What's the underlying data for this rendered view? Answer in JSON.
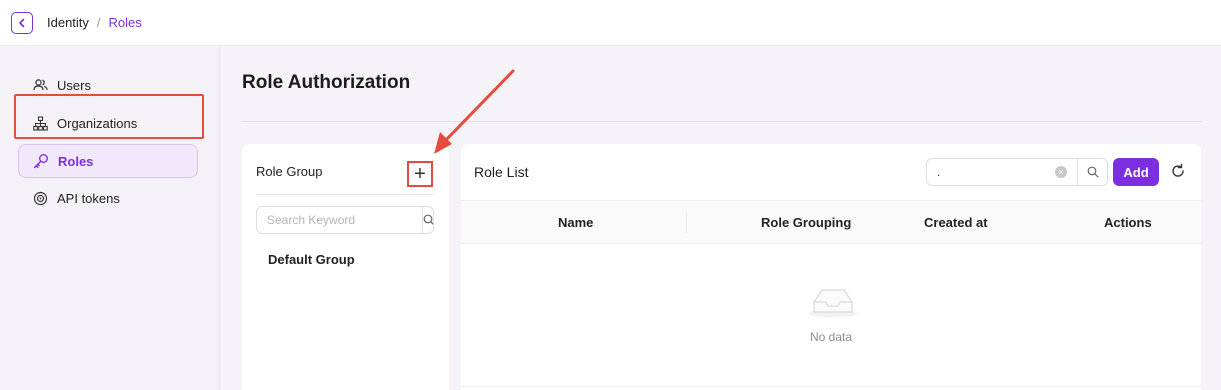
{
  "breadcrumb": {
    "parent": "Identity",
    "separator": "/",
    "current": "Roles"
  },
  "sidebar": {
    "items": [
      {
        "label": "Users",
        "icon": "users-icon"
      },
      {
        "label": "Organizations",
        "icon": "org-tree-icon"
      },
      {
        "label": "Roles",
        "icon": "key-icon",
        "active": true
      },
      {
        "label": "API tokens",
        "icon": "token-icon"
      }
    ]
  },
  "page": {
    "title": "Role Authorization"
  },
  "role_group": {
    "title": "Role Group",
    "add_symbol": "+",
    "search_placeholder": "Search Keyword",
    "items": [
      "Default Group"
    ]
  },
  "role_list": {
    "title": "Role List",
    "search_value": ".",
    "add_label": "Add",
    "columns": [
      "Name",
      "Role Grouping",
      "Created at",
      "Actions"
    ],
    "empty_text": "No data"
  },
  "colors": {
    "accent": "#7c2fe0",
    "annotation": "#e64c3c"
  }
}
